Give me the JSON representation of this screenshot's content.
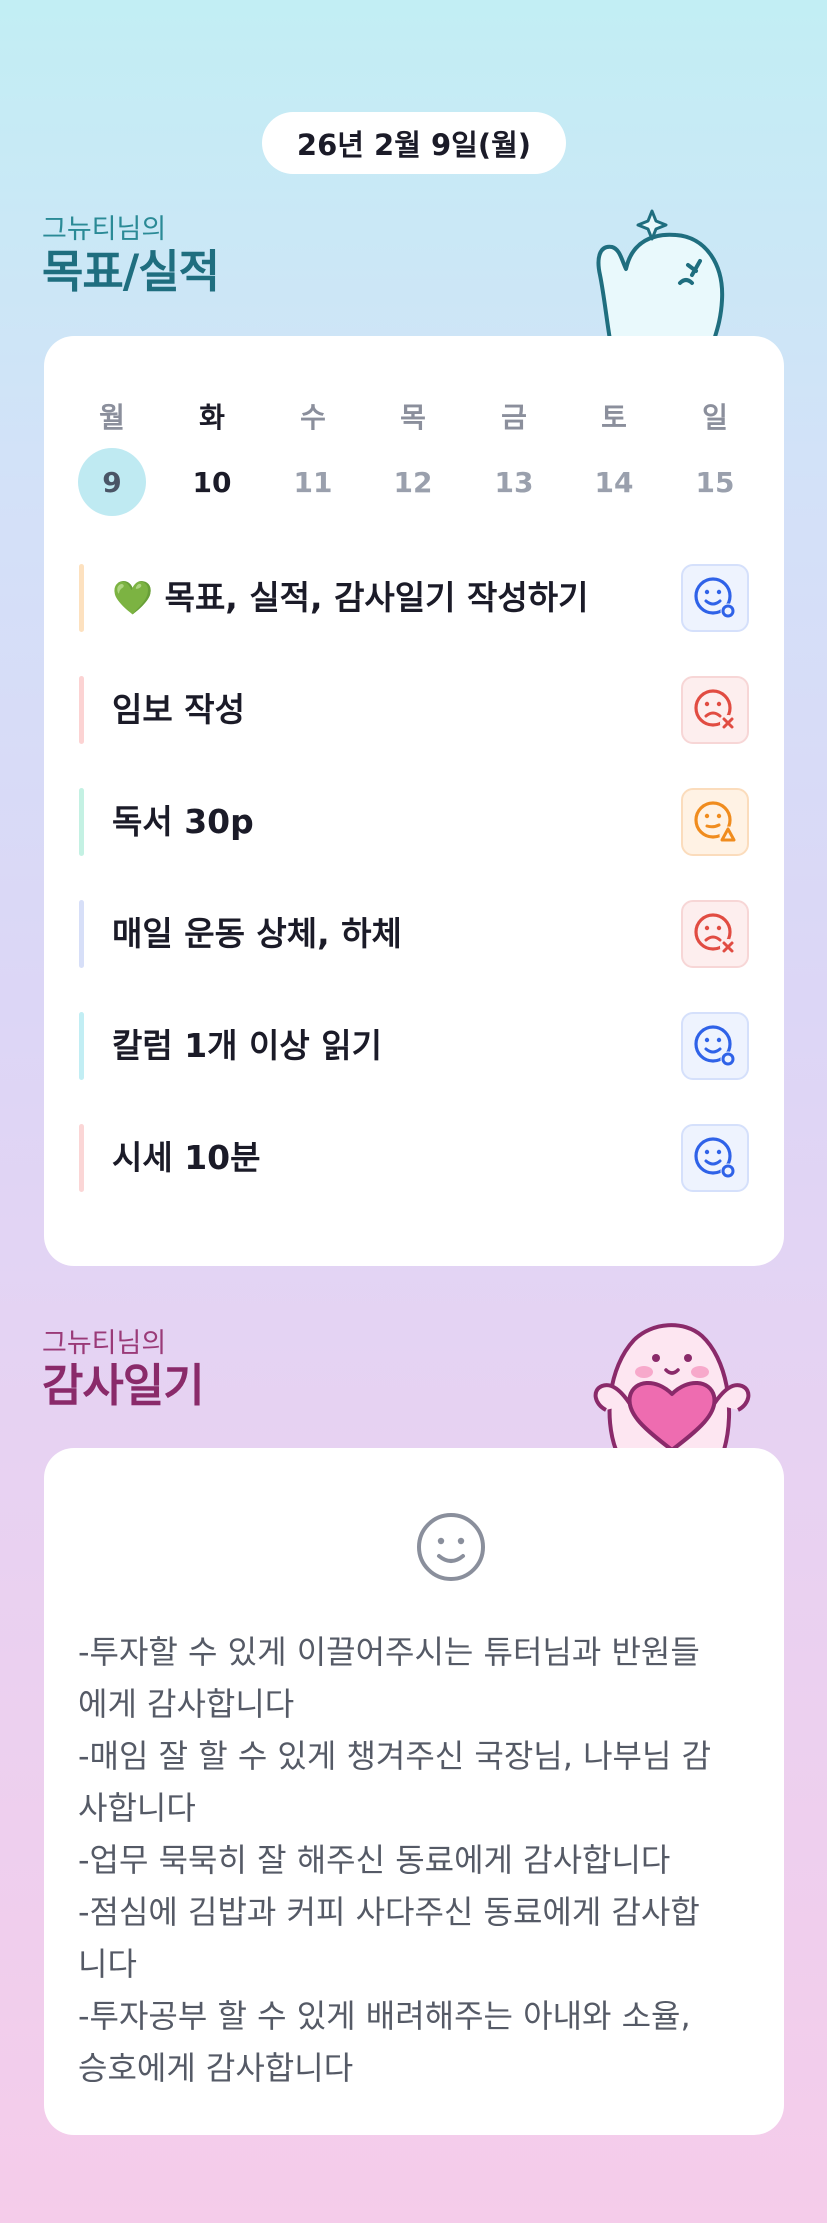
{
  "header": {
    "date": "26년 2월 9일(월)"
  },
  "goals": {
    "subtitle": "그뉴티님의",
    "title": "목표/실적",
    "weekdays": [
      "월",
      "화",
      "수",
      "목",
      "금",
      "토",
      "일"
    ],
    "dates": [
      "9",
      "10",
      "11",
      "12",
      "13",
      "14",
      "15"
    ],
    "tasks": [
      {
        "label": "💚 목표, 실적, 감사일기 작성하기",
        "bar_color": "#fde1bf",
        "status": "done",
        "status_color": "#2f62e8"
      },
      {
        "label": "임보 작성",
        "bar_color": "#fcd3d3",
        "status": "fail",
        "status_color": "#e14c42"
      },
      {
        "label": "독서 30p",
        "bar_color": "#c4f1e3",
        "status": "partial",
        "status_color": "#f08c1e"
      },
      {
        "label": "매일 운동 상체, 하체",
        "bar_color": "#d7dff8",
        "status": "fail",
        "status_color": "#e14c42"
      },
      {
        "label": "칼럼 1개 이상 읽기",
        "bar_color": "#c2eef4",
        "status": "done",
        "status_color": "#2f62e8"
      },
      {
        "label": "시세 10분",
        "bar_color": "#fbd6d6",
        "status": "done",
        "status_color": "#2f62e8"
      }
    ]
  },
  "gratitude": {
    "subtitle": "그뉴티님의",
    "title": "감사일기",
    "mood_icon": "smiley-face-icon",
    "text": "-투자할 수 있게 이끌어주시는 튜터님과 반원들\n에게 감사합니다\n-매임 잘 할 수 있게 챙겨주신 국장님, 나부님 감\n사합니다\n-업무 묵묵히 잘 해주신 동료에게 감사합니다\n-점심에 김밥과 커피 사다주신 동료에게 감사합\n니다\n-투자공부 할 수 있게 배려해주는 아내와 소율,\n승호에게 감사합니다"
  }
}
